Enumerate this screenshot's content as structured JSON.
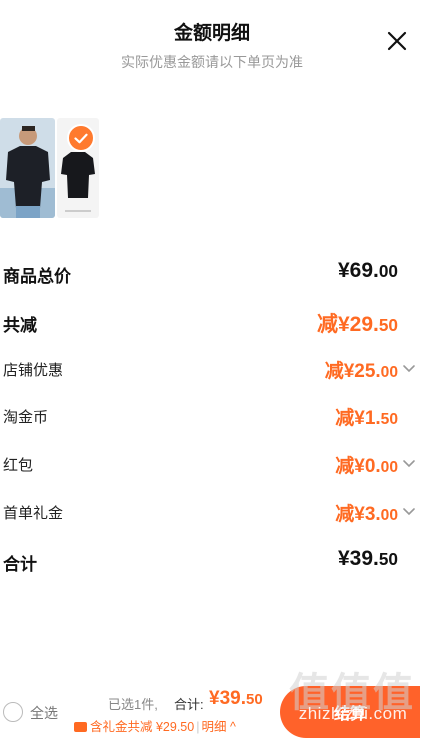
{
  "header": {
    "title": "金额明细",
    "subtitle": "实际优惠金额请以下单页为准"
  },
  "rows": [
    {
      "label": "商品总价",
      "amount_int": "¥69.",
      "amount_dec": "00",
      "style": "black",
      "bold": true,
      "has_chevron": false
    },
    {
      "label": "共减",
      "amount_int": "减¥29.",
      "amount_dec": "50",
      "style": "orange",
      "bold": true,
      "has_chevron": false
    },
    {
      "label": "店铺优惠",
      "amount_int": "减¥25.",
      "amount_dec": "00",
      "style": "orange",
      "bold": false,
      "has_chevron": true
    },
    {
      "label": "淘金币",
      "amount_int": "减¥1.",
      "amount_dec": "50",
      "style": "orange",
      "bold": false,
      "has_chevron": false
    },
    {
      "label": "红包",
      "amount_int": "减¥0.",
      "amount_dec": "00",
      "style": "orange",
      "bold": false,
      "has_chevron": true
    },
    {
      "label": "首单礼金",
      "amount_int": "减¥3.",
      "amount_dec": "00",
      "style": "orange",
      "bold": false,
      "has_chevron": true
    },
    {
      "label": "合计",
      "amount_int": "¥39.",
      "amount_dec": "50",
      "style": "black",
      "bold": true,
      "has_chevron": false
    }
  ],
  "bottom_bar": {
    "select_all": "全选",
    "selected_count": "已选1件,",
    "total_label": "合计:",
    "total_int": "¥39.",
    "total_dec": "50",
    "coupon_text": "含礼金共减 ¥29.50",
    "detail_label": "明细",
    "detail_arrow": "^",
    "checkout_label": "结算",
    "watermark": "值值值",
    "watermark_url": "zhizhizhi.com"
  },
  "colors": {
    "accent": "#ff6a22",
    "checkout": "#ff5a1f",
    "subtitle": "#999999"
  },
  "icons": {
    "close": "close-icon",
    "check": "checkmark-icon",
    "chevron": "chevron-down-icon",
    "coupon": "coupon-icon"
  }
}
